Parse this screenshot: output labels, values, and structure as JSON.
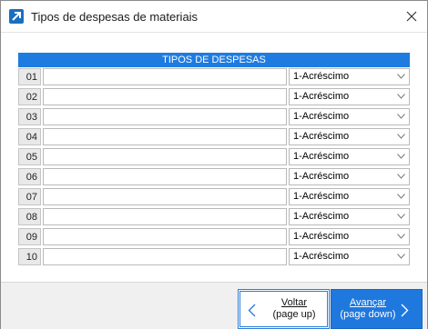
{
  "window": {
    "title": "Tipos de despesas de materiais"
  },
  "grid": {
    "header": "TIPOS DE DESPESAS",
    "rows": [
      {
        "num": "01",
        "value": "",
        "type": "1-Acréscimo"
      },
      {
        "num": "02",
        "value": "",
        "type": "1-Acréscimo"
      },
      {
        "num": "03",
        "value": "",
        "type": "1-Acréscimo"
      },
      {
        "num": "04",
        "value": "",
        "type": "1-Acréscimo"
      },
      {
        "num": "05",
        "value": "",
        "type": "1-Acréscimo"
      },
      {
        "num": "06",
        "value": "",
        "type": "1-Acréscimo"
      },
      {
        "num": "07",
        "value": "",
        "type": "1-Acréscimo"
      },
      {
        "num": "08",
        "value": "",
        "type": "1-Acréscimo"
      },
      {
        "num": "09",
        "value": "",
        "type": "1-Acréscimo"
      },
      {
        "num": "10",
        "value": "",
        "type": "1-Acréscimo"
      }
    ]
  },
  "footer": {
    "back": {
      "line1": "Voltar",
      "line2": "(page up)"
    },
    "next": {
      "line1": "Avançar",
      "line2": "(page down)"
    }
  },
  "colors": {
    "accent": "#1e7be0",
    "header_bg": "#1e7be0",
    "next_button_bg": "#1f78de"
  },
  "icons": {
    "app": "external-link-arrow-icon",
    "close": "close-icon",
    "select": "chevron-down-icon",
    "back": "chevron-left-icon",
    "next": "chevron-right-icon"
  }
}
